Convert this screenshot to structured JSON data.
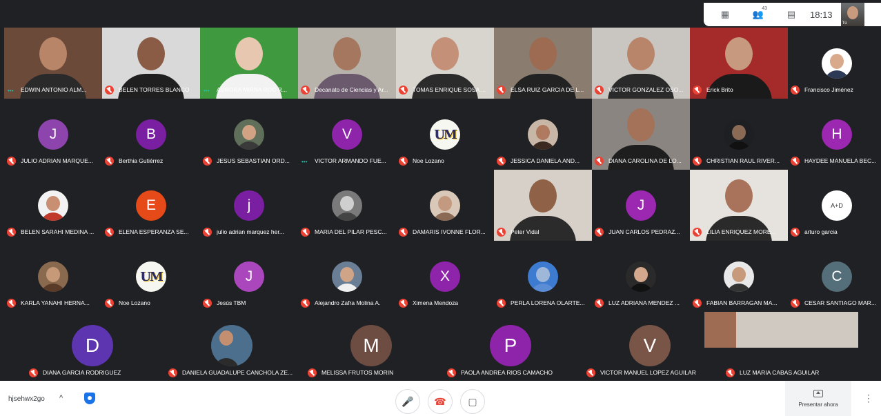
{
  "top_bar": {
    "time": "18:13",
    "participants_count": "43",
    "self_label": "Tú"
  },
  "grid": {
    "rows": [
      [
        {
          "name": "EDWIN ANTONIO ALM...",
          "type": "video",
          "speaking": true,
          "bg": "#6b4a3a",
          "skin": "#b98568",
          "shirt": "#2a2a2a"
        },
        {
          "name": "BELEN TORRES BLANCO",
          "type": "video",
          "bg": "#d9d9d9",
          "skin": "#8a5c45",
          "shirt": "#1f1f1f"
        },
        {
          "name": "AURORA MIRNA ROC R...",
          "type": "video",
          "speaking": true,
          "bg": "#3f9a3f",
          "skin": "#e8c7b0",
          "shirt": "#f2f2f2"
        },
        {
          "name": "Decanato de Ciencias y Ar...",
          "type": "video",
          "bg": "#b7b2aa",
          "skin": "#a5775e",
          "shirt": "#6b5a6e"
        },
        {
          "name": "TOMAS ENRIQUE SOSA ...",
          "type": "video",
          "bg": "#d8d4ce",
          "skin": "#c49077",
          "shirt": "#2b2b2b"
        },
        {
          "name": "ELSA RUIZ GARCIA DE L...",
          "type": "video",
          "bg": "#8a7d70",
          "skin": "#9c6b52",
          "shirt": "#222"
        },
        {
          "name": "VICTOR GONZALEZ OSO...",
          "type": "video",
          "bg": "#c9c6c1",
          "skin": "#b8856a",
          "shirt": "#2a2a2a"
        },
        {
          "name": "Erick Brito",
          "type": "video",
          "bg": "#a52a2a",
          "skin": "#c79a80",
          "shirt": "#1a1a1a"
        },
        {
          "name": "Francisco Jiménez",
          "type": "avatar",
          "kind": "photo",
          "color": "#ffffff",
          "skin": "#d9a98b",
          "shirt": "#2d3a55"
        }
      ],
      [
        {
          "name": "JULIO ADRIAN MARQUE...",
          "type": "avatar",
          "letter": "J",
          "color": "#8e44ad"
        },
        {
          "name": "Berthia Gutiérrez",
          "type": "avatar",
          "letter": "B",
          "color": "#7b1fa2"
        },
        {
          "name": "JESUS SEBASTIAN ORD...",
          "type": "avatar",
          "kind": "photo",
          "color": "#5f6f5a",
          "skin": "#d2a284",
          "shirt": "#3a3a3a"
        },
        {
          "name": "VICTOR ARMANDO FUE...",
          "type": "avatar",
          "letter": "V",
          "color": "#8e24aa",
          "speaking": true
        },
        {
          "name": "Noe Lozano",
          "type": "avatar",
          "kind": "logo",
          "letter": "UM"
        },
        {
          "name": "JESSICA DANIELA AND...",
          "type": "avatar",
          "kind": "photo",
          "color": "#c8b6a6",
          "skin": "#b07a60",
          "shirt": "#3b2a22"
        },
        {
          "name": "DIANA CAROLINA DE LO...",
          "type": "video",
          "bg": "#8a8580",
          "skin": "#a47258",
          "shirt": "#1e1e1e"
        },
        {
          "name": "CHRISTIAN RAUL RIVER...",
          "type": "avatar",
          "kind": "photo",
          "color": "#1d1f22",
          "skin": "#8a6a55",
          "shirt": "#111"
        },
        {
          "name": "HAYDEE MANUELA BEC...",
          "type": "avatar",
          "letter": "H",
          "color": "#9c27b0"
        }
      ],
      [
        {
          "name": "BELEN SARAHI MEDINA ...",
          "type": "avatar",
          "kind": "photo",
          "color": "#f2f2f2",
          "skin": "#c98f73",
          "shirt": "#c0392b"
        },
        {
          "name": "ELENA ESPERANZA SE...",
          "type": "avatar",
          "letter": "E",
          "color": "#e64a19"
        },
        {
          "name": "julio adrian marquez her...",
          "type": "avatar",
          "letter": "j",
          "color": "#7b1fa2"
        },
        {
          "name": "MARIA DEL PILAR PESC...",
          "type": "avatar",
          "kind": "photo",
          "color": "#7a7a7a",
          "skin": "#cfcfcf",
          "shirt": "#444"
        },
        {
          "name": "DAMARIS IVONNE FLOR...",
          "type": "avatar",
          "kind": "photo",
          "color": "#d9c8b8",
          "skin": "#c39a7f",
          "shirt": "#8a6a55"
        },
        {
          "name": "Peter Vidal",
          "type": "video",
          "bg": "#d6d0c8",
          "skin": "#8f6248",
          "shirt": "#2b2b2b"
        },
        {
          "name": "JUAN CARLOS PEDRAZ...",
          "type": "avatar",
          "letter": "J",
          "color": "#9c27b0"
        },
        {
          "name": "LILIA ENRIQUEZ MORE...",
          "type": "video",
          "bg": "#e6e2dd",
          "skin": "#a8735a",
          "shirt": "#2a2a2a"
        },
        {
          "name": "arturo garcia",
          "type": "avatar",
          "kind": "logo2",
          "letter": "A+D",
          "color": "#ffffff"
        }
      ],
      [
        {
          "name": "KARLA YANAHI HERNA...",
          "type": "avatar",
          "kind": "photo",
          "color": "#8a6a4f",
          "skin": "#c69a78",
          "shirt": "#5a3b28"
        },
        {
          "name": "Noe Lozano",
          "type": "avatar",
          "kind": "logo",
          "letter": "UM"
        },
        {
          "name": "Jesús TBM",
          "type": "avatar",
          "letter": "J",
          "color": "#ab47bc"
        },
        {
          "name": "Alejandro Zafra Molina A.",
          "type": "avatar",
          "kind": "photo",
          "color": "#6a7f95",
          "skin": "#cfa487",
          "shirt": "#f0f0f0"
        },
        {
          "name": "Ximena Mendoza",
          "type": "avatar",
          "letter": "X",
          "color": "#8e24aa"
        },
        {
          "name": "PERLA LORENA OLARTE...",
          "type": "avatar",
          "kind": "photo",
          "color": "#3d7bd1",
          "skin": "#9fb7d8",
          "shirt": "#5b8dd6"
        },
        {
          "name": "LUZ ADRIANA MENDEZ ...",
          "type": "avatar",
          "kind": "photo",
          "color": "#2a2a2a",
          "skin": "#d3a88c",
          "shirt": "#111"
        },
        {
          "name": "FABIAN BARRAGAN MA...",
          "type": "avatar",
          "kind": "photo",
          "color": "#e8e8e8",
          "skin": "#c79a7c",
          "shirt": "#333"
        },
        {
          "name": "CESAR SANTIAGO MAR...",
          "type": "avatar",
          "letter": "C",
          "color": "#546e7a"
        }
      ]
    ]
  },
  "bottom_row": [
    {
      "name": "DIANA GARCIA RODRIGUEZ",
      "type": "avatar",
      "letter": "D",
      "color": "#5e35b1"
    },
    {
      "name": "DANIELA GUADALUPE CANCHOLA ZE...",
      "type": "avatar",
      "kind": "photo",
      "color": "#4c6f8e",
      "skin": "#c48f70",
      "shirt": "#2b2b2b"
    },
    {
      "name": "MELISSA FRUTOS MORIN",
      "type": "avatar",
      "letter": "M",
      "color": "#6d4c41"
    },
    {
      "name": "PAOLA ANDREA RIOS CAMACHO",
      "type": "avatar",
      "letter": "P",
      "color": "#8e24aa"
    },
    {
      "name": "VICTOR MANUEL LOPEZ AGUILAR",
      "type": "avatar",
      "letter": "V",
      "color": "#795548"
    },
    {
      "name": "LUZ MARIA CABAS AGUILAR",
      "type": "video",
      "bg": "#cfc9c2",
      "skin": "#9e6c52",
      "shirt": "#e6e6e6"
    }
  ],
  "bottom_bar": {
    "meeting_code": "hjsehwx2go",
    "chevron": "^",
    "present_label": "Presentar ahora",
    "controls": {
      "mic_icon": "mic-icon",
      "hangup_icon": "phone-hangup-icon",
      "camera_icon": "camera-icon"
    }
  },
  "colors": {
    "accent_speaking": "#1fc0a8",
    "muted_red": "#ea4335",
    "background": "#202124"
  }
}
